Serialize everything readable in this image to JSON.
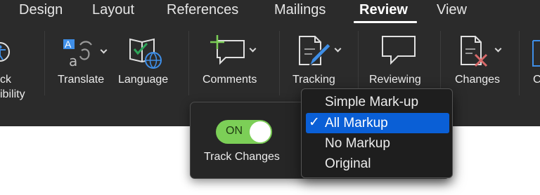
{
  "tabs": [
    "Design",
    "Layout",
    "References",
    "Mailings",
    "Review",
    "View"
  ],
  "active_tab": "Review",
  "ribbon": {
    "accessibility_label_line1": "ck",
    "accessibility_label_line2": "ibility",
    "translate_label": "Translate",
    "language_label": "Language",
    "comments_label": "Comments",
    "tracking_label": "Tracking",
    "reviewing_label": "Reviewing",
    "changes_label": "Changes",
    "partial_label": "C"
  },
  "track_changes": {
    "toggle_text": "ON",
    "toggle_state": "on",
    "label": "Track Changes"
  },
  "markup_menu": {
    "items": [
      "Simple Mark-up",
      "All Markup",
      "No Markup",
      "Original"
    ],
    "selected": "All Markup",
    "check_glyph": "✓"
  },
  "colors": {
    "ribbon_bg": "#2b2b2b",
    "toggle_on": "#7ccf57",
    "selection": "#0a5fd6",
    "translate_accent": "#3f8fe8",
    "language_accent": "#2fa65a",
    "globe": "#3f8fe8",
    "changes_x": "#d86a6a"
  },
  "icons": [
    "accessibility-icon",
    "translate-icon",
    "language-icon",
    "comment-add-icon",
    "tracking-pen-icon",
    "reviewing-bubble-icon",
    "changes-reject-icon"
  ]
}
